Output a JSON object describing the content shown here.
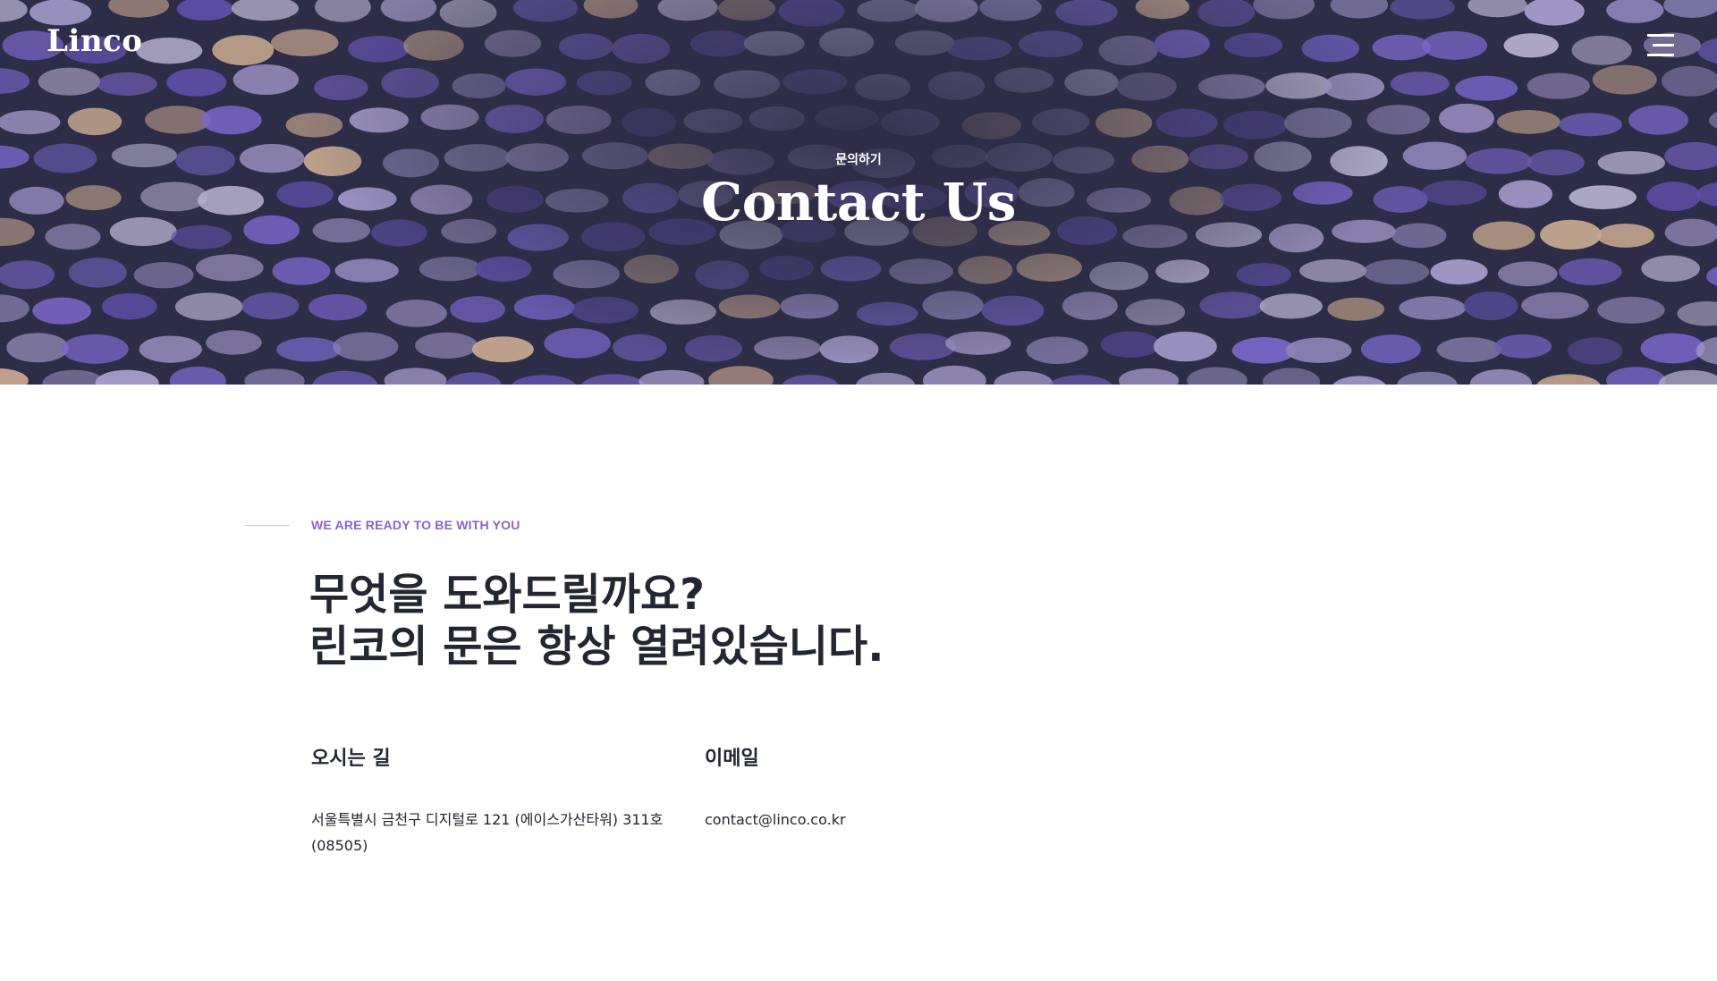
{
  "header": {
    "logo": "Linco",
    "menu_icon": "hamburger-menu-icon"
  },
  "hero": {
    "subtitle": "문의하기",
    "title": "Contact Us"
  },
  "contact": {
    "eyebrow": "WE ARE READY TO BE WITH YOU",
    "headline_line1": "무엇을 도와드릴까요?",
    "headline_line2": "린코의 문은 항상 열려있습니다.",
    "address": {
      "title": "오시는 길",
      "line1": "서울특별시 금천구 디지털로 121 (에이스가산타워) 311호",
      "line2": "(08505)"
    },
    "email": {
      "title": "이메일",
      "value": "contact@linco.co.kr"
    }
  },
  "colors": {
    "hero_bg": "#2e2d47",
    "accent": "#8a63c7",
    "text_dark": "#232732"
  }
}
